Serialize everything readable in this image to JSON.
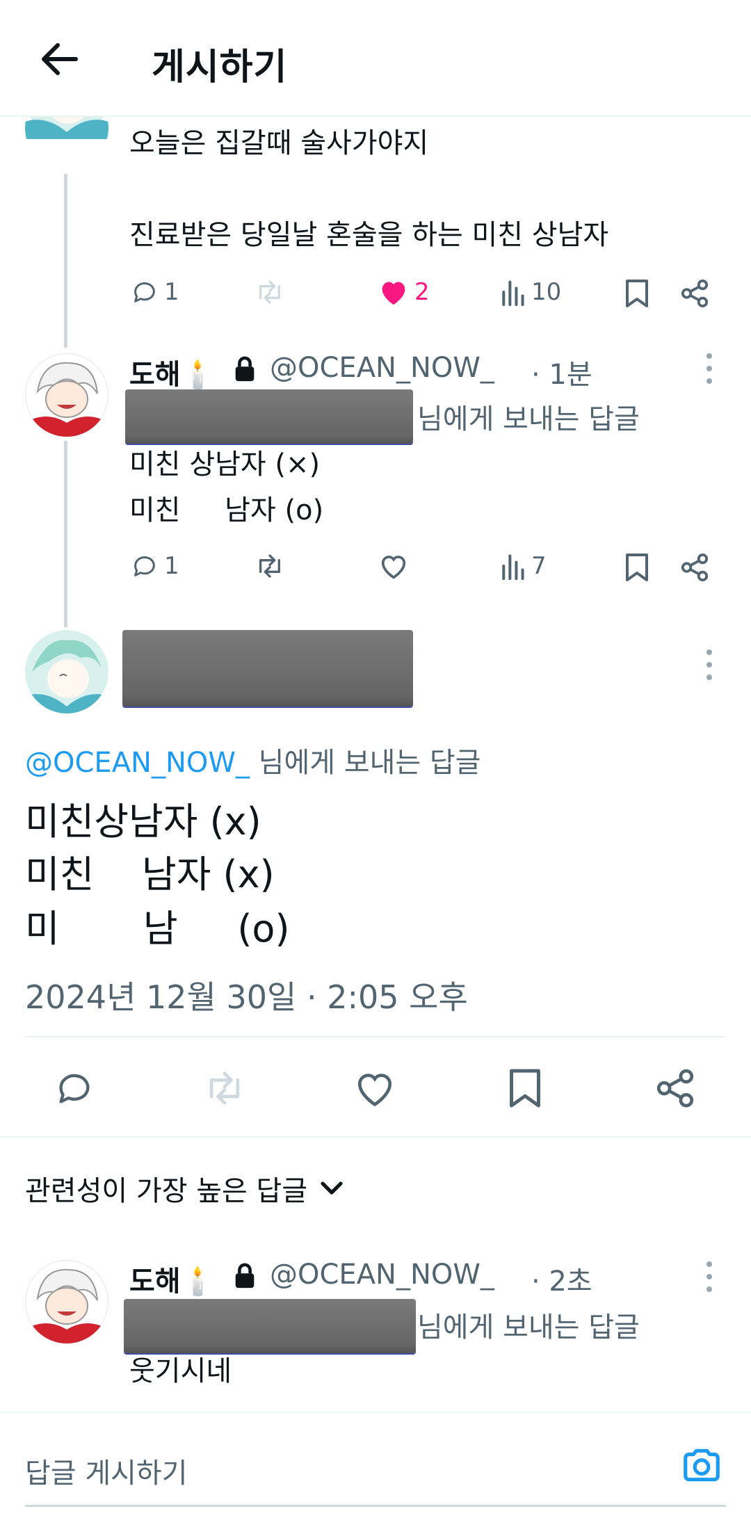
{
  "header": {
    "title": "게시하기"
  },
  "prev_tweet": {
    "line1": "오늘은 집갈때 술사가야지",
    "line2": "진료받은 당일날 혼술을 하는 미친 상남자",
    "replies": "1",
    "likes": "2",
    "views": "10",
    "like_color": "#f91880"
  },
  "reply_tweet": {
    "name": "도해🕯️",
    "handle": "@OCEAN_NOW_",
    "time": "· 1분",
    "reply_to_suffix": "님에게 보내는 답글",
    "line1": "미친 상남자 (×)",
    "line2": "미친     남자 (o)",
    "replies": "1",
    "views": "7"
  },
  "main_tweet": {
    "reply_to_handle": "@OCEAN_NOW_",
    "reply_to_suffix": " 님에게 보내는 답글",
    "text_line1": "미친상남자 (x)",
    "text_line2": "미친    남자 (x)",
    "text_line3": "미       남     (o)",
    "timestamp": "2024년 12월 30일 · 2:05 오후"
  },
  "replies_section": {
    "sort_label": "관련성이 가장 높은 답글"
  },
  "bottom_reply": {
    "name": "도해🕯️",
    "handle": "@OCEAN_NOW_",
    "time": "· 2초",
    "reply_to_suffix": "님에게 보내는 답글",
    "text": "웃기시네"
  },
  "composer": {
    "placeholder": "답글 게시하기"
  },
  "colors": {
    "accent": "#1d9bf0",
    "muted": "#536471",
    "like": "#f91880"
  }
}
